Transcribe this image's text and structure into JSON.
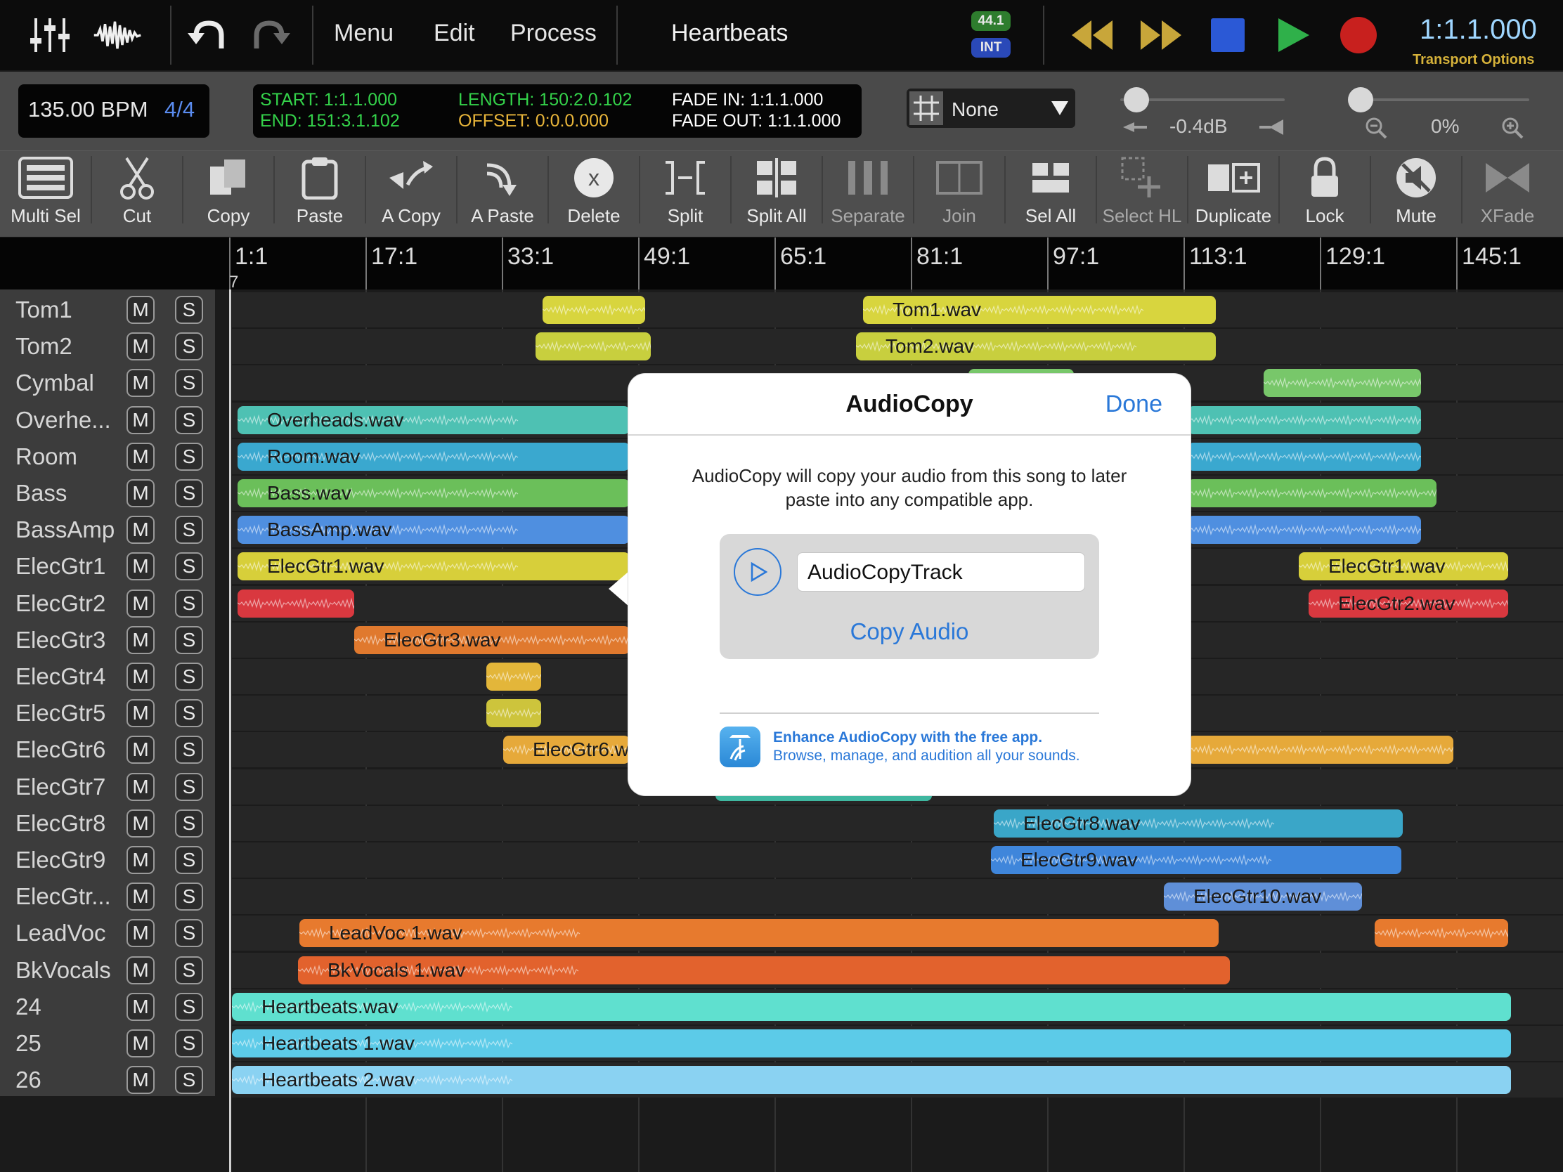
{
  "app": {
    "song_title": "Heartbeats"
  },
  "menu": {
    "items": [
      "Menu",
      "Edit",
      "Process"
    ]
  },
  "audio_status": {
    "sample_rate": "44.1",
    "clock": "INT"
  },
  "transport": {
    "time": "1:1.1.000",
    "options_label": "Transport Options"
  },
  "tempo": {
    "bpm": "135.00 BPM",
    "time_signature": "4/4"
  },
  "locators": {
    "start": "START: 1:1.1.000",
    "end": "END: 151:3.1.102",
    "length": "LENGTH: 150:2.0.102",
    "offset": "OFFSET: 0:0.0.000",
    "fade_in": "FADE IN: 1:1.1.000",
    "fade_out": "FADE OUT: 1:1.1.000"
  },
  "snap": {
    "value": "None"
  },
  "volume": {
    "value": "-0.4dB",
    "level": 0.1
  },
  "zoom": {
    "value": "0%",
    "level": 0.0
  },
  "toolbar": {
    "tools": [
      {
        "label": "Multi Sel",
        "icon": "multi-select-icon",
        "enabled": true
      },
      {
        "label": "Cut",
        "icon": "scissors-icon",
        "enabled": true
      },
      {
        "label": "Copy",
        "icon": "copy-icon",
        "enabled": true
      },
      {
        "label": "Paste",
        "icon": "clipboard-icon",
        "enabled": true
      },
      {
        "label": "A Copy",
        "icon": "audiocopy-icon",
        "enabled": true
      },
      {
        "label": "A Paste",
        "icon": "audiopaste-icon",
        "enabled": true
      },
      {
        "label": "Delete",
        "icon": "delete-icon",
        "enabled": true
      },
      {
        "label": "Split",
        "icon": "split-icon",
        "enabled": true
      },
      {
        "label": "Split All",
        "icon": "split-all-icon",
        "enabled": true
      },
      {
        "label": "Separate",
        "icon": "separate-icon",
        "enabled": false
      },
      {
        "label": "Join",
        "icon": "join-icon",
        "enabled": false
      },
      {
        "label": "Sel All",
        "icon": "select-all-icon",
        "enabled": true
      },
      {
        "label": "Select HL",
        "icon": "select-hl-icon",
        "enabled": false
      },
      {
        "label": "Duplicate",
        "icon": "duplicate-icon",
        "enabled": true
      },
      {
        "label": "Lock",
        "icon": "lock-icon",
        "enabled": true
      },
      {
        "label": "Mute",
        "icon": "mute-icon",
        "enabled": true
      },
      {
        "label": "XFade",
        "icon": "crossfade-icon",
        "enabled": false
      }
    ]
  },
  "ruler": {
    "marks": [
      "1:1",
      "17:1",
      "33:1",
      "49:1",
      "65:1",
      "81:1",
      "97:1",
      "113:1",
      "129:1",
      "145:1"
    ],
    "playhead_label": "7"
  },
  "track_buttons": {
    "mute": "M",
    "solo": "S"
  },
  "tracks": [
    {
      "name": "Tom1"
    },
    {
      "name": "Tom2"
    },
    {
      "name": "Cymbal"
    },
    {
      "name": "Overhe..."
    },
    {
      "name": "Room"
    },
    {
      "name": "Bass"
    },
    {
      "name": "BassAmp"
    },
    {
      "name": "ElecGtr1"
    },
    {
      "name": "ElecGtr2"
    },
    {
      "name": "ElecGtr3"
    },
    {
      "name": "ElecGtr4"
    },
    {
      "name": "ElecGtr5"
    },
    {
      "name": "ElecGtr6"
    },
    {
      "name": "ElecGtr7"
    },
    {
      "name": "ElecGtr8"
    },
    {
      "name": "ElecGtr9"
    },
    {
      "name": "ElecGtr..."
    },
    {
      "name": "LeadVoc"
    },
    {
      "name": "BkVocals"
    },
    {
      "name": "24"
    },
    {
      "name": "25"
    },
    {
      "name": "26"
    }
  ],
  "clips": [
    {
      "track": 0,
      "name": "",
      "color": "#d8d53e"
    },
    {
      "track": 0,
      "name": "Tom1.wav",
      "color": "#d8d53e"
    },
    {
      "track": 1,
      "name": "",
      "color": "#c8cf3e"
    },
    {
      "track": 1,
      "name": "Tom2.wav",
      "color": "#c8cf3e"
    },
    {
      "track": 2,
      "name": "",
      "color": "#78c76a"
    },
    {
      "track": 2,
      "name": "",
      "color": "#78c76a"
    },
    {
      "track": 3,
      "name": "Overheads.wav",
      "color": "#4ec1b3"
    },
    {
      "track": 4,
      "name": "Room.wav",
      "color": "#3aa8cf"
    },
    {
      "track": 5,
      "name": "Bass.wav",
      "color": "#6bbf5a"
    },
    {
      "track": 6,
      "name": "BassAmp.wav",
      "color": "#4f8fe0"
    },
    {
      "track": 7,
      "name": "ElecGtr1.wav",
      "color": "#d7cf3a"
    },
    {
      "track": 7,
      "name": "ElecGtr1.wav",
      "color": "#d7cf3a"
    },
    {
      "track": 8,
      "name": "",
      "color": "#d9383f"
    },
    {
      "track": 8,
      "name": "ElecGtr2.wav",
      "color": "#d9383f"
    },
    {
      "track": 9,
      "name": "ElecGtr3.wav",
      "color": "#e0792e"
    },
    {
      "track": 10,
      "name": "",
      "color": "#e3b63a"
    },
    {
      "track": 11,
      "name": "",
      "color": "#cdc43c"
    },
    {
      "track": 12,
      "name": "ElecGtr6.wav",
      "color": "#e6a93a"
    },
    {
      "track": 12,
      "name": "",
      "color": "#e6a93a"
    },
    {
      "track": 13,
      "name": "",
      "color": "#3fb7a0"
    },
    {
      "track": 14,
      "name": "ElecGtr8.wav",
      "color": "#3aa6c8"
    },
    {
      "track": 15,
      "name": "ElecGtr9.wav",
      "color": "#3f86db"
    },
    {
      "track": 16,
      "name": "ElecGtr10.wav",
      "color": "#5f8fd8"
    },
    {
      "track": 17,
      "name": "LeadVoc 1.wav",
      "color": "#e77a2e"
    },
    {
      "track": 17,
      "name": "",
      "color": "#e77a2e"
    },
    {
      "track": 18,
      "name": "BkVocals 1.wav",
      "color": "#e2622d"
    },
    {
      "track": 19,
      "name": "Heartbeats.wav",
      "color": "#5fe0cf"
    },
    {
      "track": 20,
      "name": "Heartbeats 1.wav",
      "color": "#5ccbe8"
    },
    {
      "track": 21,
      "name": "Heartbeats 2.wav",
      "color": "#8ad2f2"
    }
  ],
  "popover": {
    "title": "AudioCopy",
    "done_label": "Done",
    "description": "AudioCopy will copy your audio from this song to later paste into any compatible app.",
    "name_value": "AudioCopyTrack",
    "copy_label": "Copy Audio",
    "enhance_title": "Enhance AudioCopy with the free app.",
    "enhance_sub": "Browse, manage, and audition all your sounds."
  }
}
